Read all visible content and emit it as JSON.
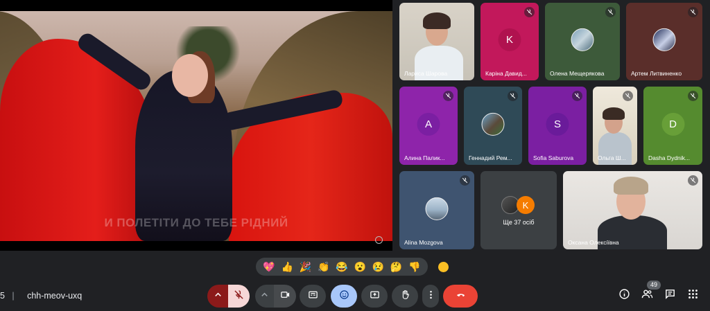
{
  "presentation": {
    "subtitle": "И ПОЛЕТІТИ ДО ТЕБЕ РІДНИЙ"
  },
  "participants": [
    {
      "name": "Лариса Шарова",
      "type": "camera"
    },
    {
      "name": "Каріна Давид...",
      "type": "letter",
      "letter": "K",
      "color": "#c2185b"
    },
    {
      "name": "Олена Мещерякова",
      "type": "photo"
    },
    {
      "name": "Артем Литвиненко",
      "type": "photo"
    },
    {
      "name": "Алина Палик...",
      "type": "letter",
      "letter": "A",
      "color": "#8e24aa"
    },
    {
      "name": "Геннадий Рем...",
      "type": "photo"
    },
    {
      "name": "Sofia Saburova",
      "type": "letter",
      "letter": "S",
      "color": "#7b1fa2"
    },
    {
      "name": "Ольга Ш...",
      "type": "camera"
    },
    {
      "name": "Dasha Dydnik...",
      "type": "letter",
      "letter": "D",
      "color": "#558b2f"
    },
    {
      "name": "Alina Mozgova",
      "type": "photo"
    },
    {
      "name": "Ще 37 осіб",
      "type": "more",
      "letter": "K"
    },
    {
      "name": "Оксана Олексіївна",
      "type": "camera"
    }
  ],
  "reactions": [
    "💖",
    "👍",
    "🎉",
    "👏",
    "😂",
    "😮",
    "😢",
    "🤔",
    "👎"
  ],
  "meeting": {
    "time_fragment": "5",
    "code": "chh-meov-uxq"
  },
  "people_count": "49",
  "colors": {
    "background": "#202124",
    "control": "#3c4043",
    "end_call": "#ea4335",
    "active_reaction": "#a8c7fa"
  },
  "icons": [
    "chevron-up-icon",
    "mic-off-icon",
    "camera-icon",
    "captions-icon",
    "emoji-icon",
    "present-icon",
    "raise-hand-icon",
    "more-icon",
    "end-call-icon",
    "info-icon",
    "people-icon",
    "chat-icon",
    "activities-icon"
  ]
}
